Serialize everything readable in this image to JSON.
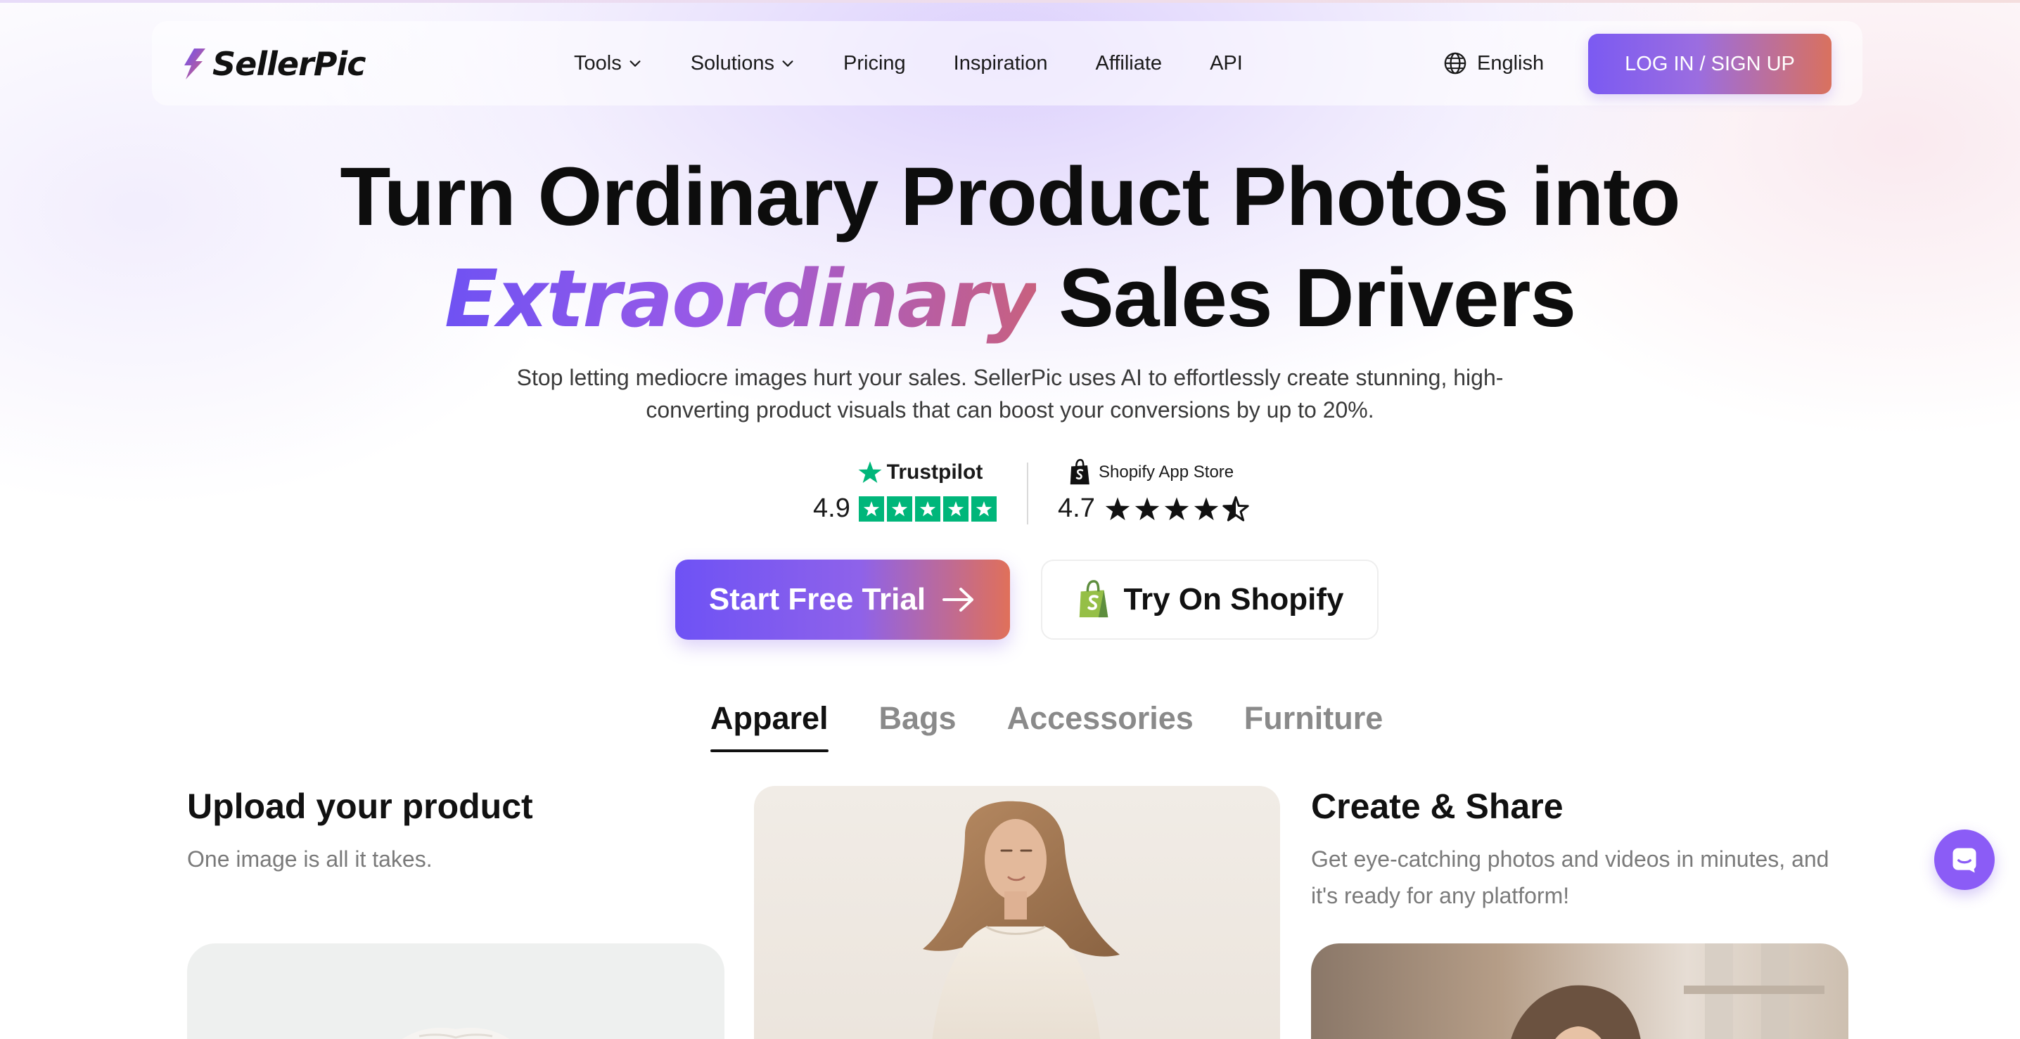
{
  "brand": {
    "name": "SellerPic"
  },
  "nav": {
    "items": [
      {
        "label": "Tools",
        "has_dropdown": true
      },
      {
        "label": "Solutions",
        "has_dropdown": true
      },
      {
        "label": "Pricing",
        "has_dropdown": false
      },
      {
        "label": "Inspiration",
        "has_dropdown": false
      },
      {
        "label": "Affiliate",
        "has_dropdown": false
      },
      {
        "label": "API",
        "has_dropdown": false
      }
    ],
    "language": "English",
    "login_label": "LOG IN / SIGN UP"
  },
  "hero": {
    "title_line1": "Turn Ordinary Product Photos into",
    "title_highlight": "Extraordinary",
    "title_line2_rest": " Sales Drivers",
    "subtitle_line1": "Stop letting mediocre images hurt your sales. SellerPic uses AI to effortlessly create stunning, high-",
    "subtitle_line2": "converting product visuals that can boost your conversions by up to 20%."
  },
  "ratings": {
    "trustpilot": {
      "brand": "Trustpilot",
      "score": "4.9",
      "stars": 5
    },
    "shopify": {
      "brand": "Shopify App Store",
      "score": "4.7",
      "stars": 4.5
    }
  },
  "cta": {
    "primary_label": "Start Free Trial",
    "secondary_label": "Try On Shopify"
  },
  "tabs": [
    {
      "label": "Apparel",
      "active": true
    },
    {
      "label": "Bags",
      "active": false
    },
    {
      "label": "Accessories",
      "active": false
    },
    {
      "label": "Furniture",
      "active": false
    }
  ],
  "steps": {
    "upload": {
      "title": "Upload your product",
      "desc": "One image is all it takes."
    },
    "share": {
      "title": "Create & Share",
      "desc": "Get eye-catching photos and videos in minutes, and it's ready for any platform!"
    }
  },
  "colors": {
    "accent_purple": "#7b5af2",
    "accent_coral": "#d9715e",
    "trustpilot_green": "#00b67a",
    "chat_bubble": "#8b5cf6"
  },
  "icons": {
    "language": "globe-icon",
    "dropdown": "chevron-down-icon",
    "arrow": "arrow-right-icon",
    "shopify": "shopify-bag-icon",
    "chat": "chat-icon"
  }
}
